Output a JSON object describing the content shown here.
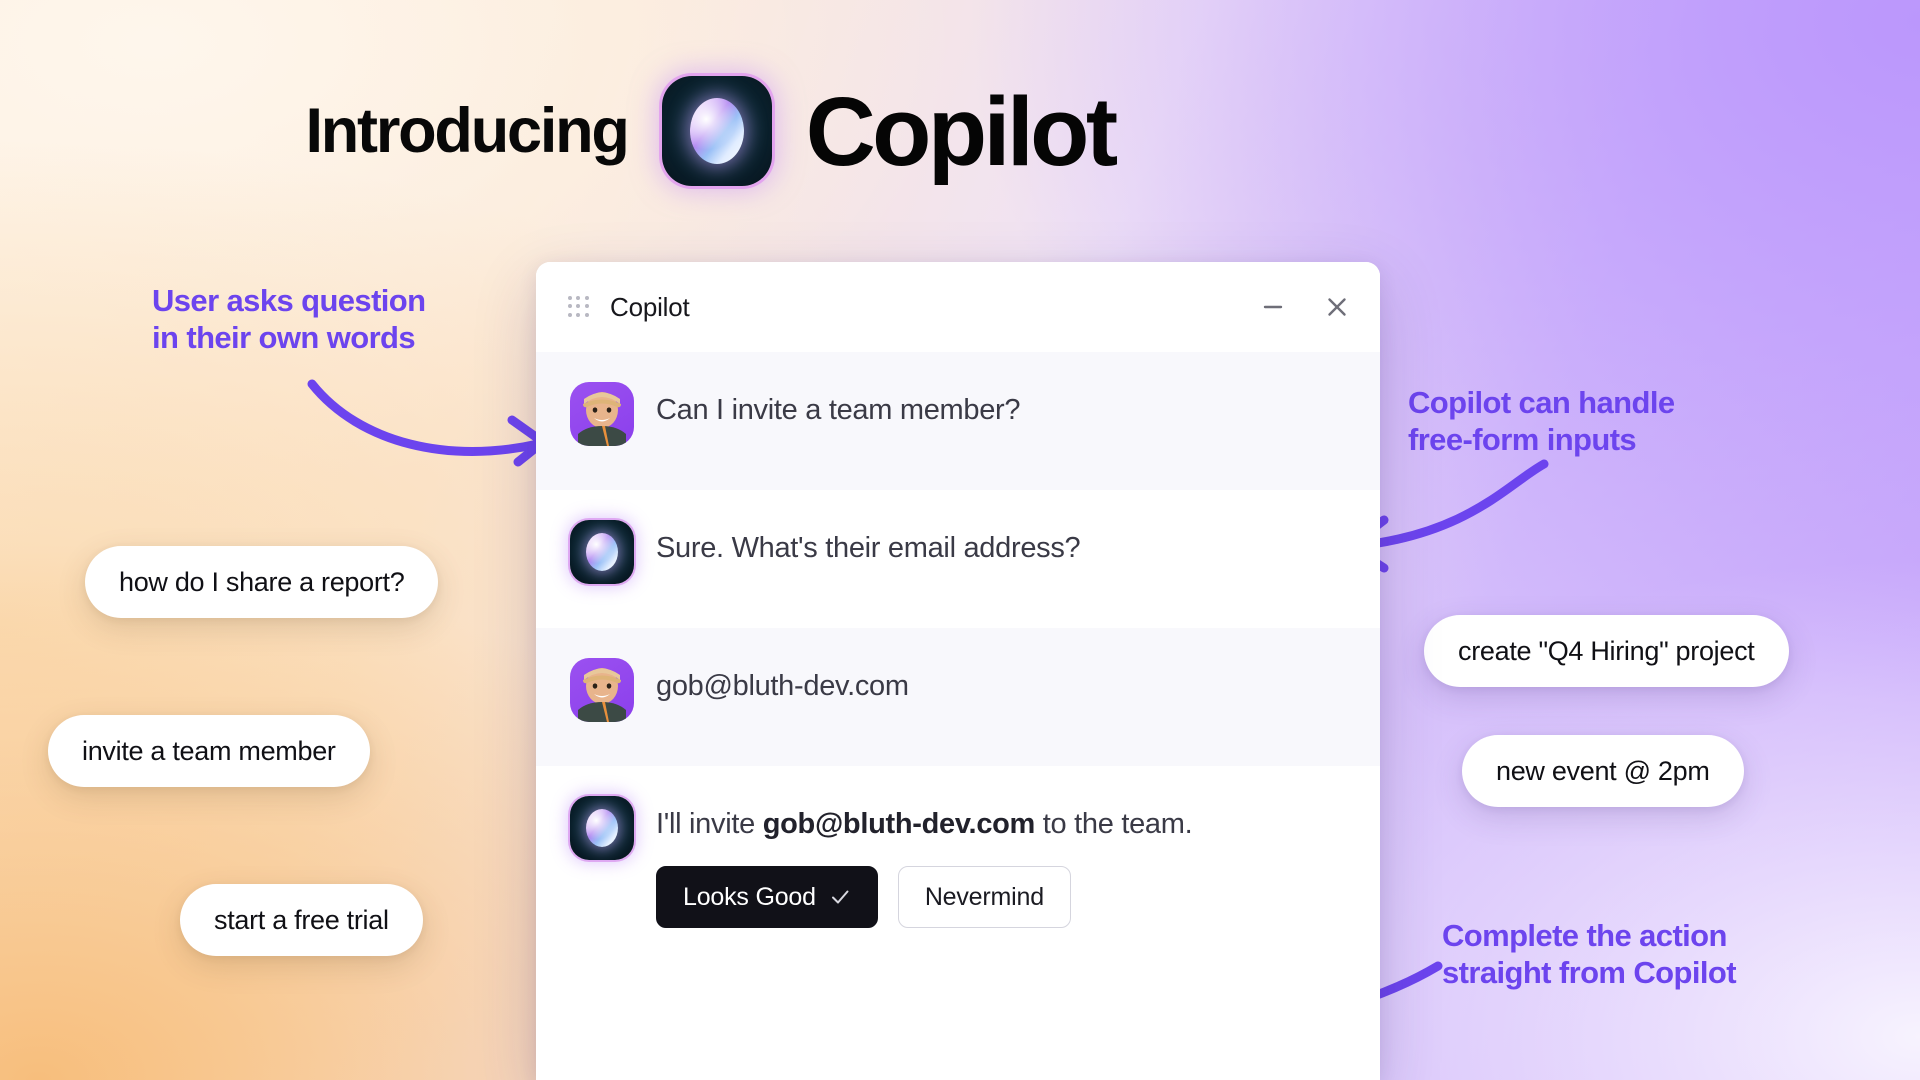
{
  "headline": {
    "intro": "Introducing",
    "brand": "Copilot",
    "logo_icon": "copilot-orb-icon"
  },
  "chat": {
    "title": "Copilot",
    "menu_icon": "grid-dots-icon",
    "minimize_icon": "minimize-icon",
    "close_icon": "close-icon",
    "messages": [
      {
        "sender": "user",
        "avatar": "user-photo-avatar",
        "text": "Can I invite a team member?"
      },
      {
        "sender": "bot",
        "avatar": "copilot-orb-avatar",
        "text": "Sure. What's their email address?"
      },
      {
        "sender": "user",
        "avatar": "user-photo-avatar",
        "text": "gob@bluth-dev.com"
      }
    ],
    "final_message": {
      "sender": "bot",
      "avatar": "copilot-orb-avatar",
      "text_before": "I'll invite ",
      "text_bold": "gob@bluth-dev.com",
      "text_after": " to the team.",
      "primary_button": "Looks Good",
      "primary_button_icon": "check-icon",
      "secondary_button": "Nevermind"
    }
  },
  "annotations": [
    {
      "text": "User asks question\nin their own words"
    },
    {
      "text": "Copilot can handle\nfree-form inputs"
    },
    {
      "text": "Complete the action\nstraight from Copilot"
    }
  ],
  "pills": [
    {
      "text": "how do I share a report?"
    },
    {
      "text": "invite a team member"
    },
    {
      "text": "start a free trial"
    },
    {
      "text": "create \"Q4 Hiring\" project"
    },
    {
      "text": "new event @ 2pm"
    }
  ],
  "colors": {
    "accent_purple": "#6C44EE",
    "background_cream": "#FEF6EC",
    "background_orange": "#F7BE7C",
    "background_lavender": "#BB97FC",
    "background_pale": "#F7F3FE",
    "user_row_bg": "#F8F8FC",
    "bot_row_bg": "#FFFFFF",
    "primary_button_bg": "#111118"
  }
}
